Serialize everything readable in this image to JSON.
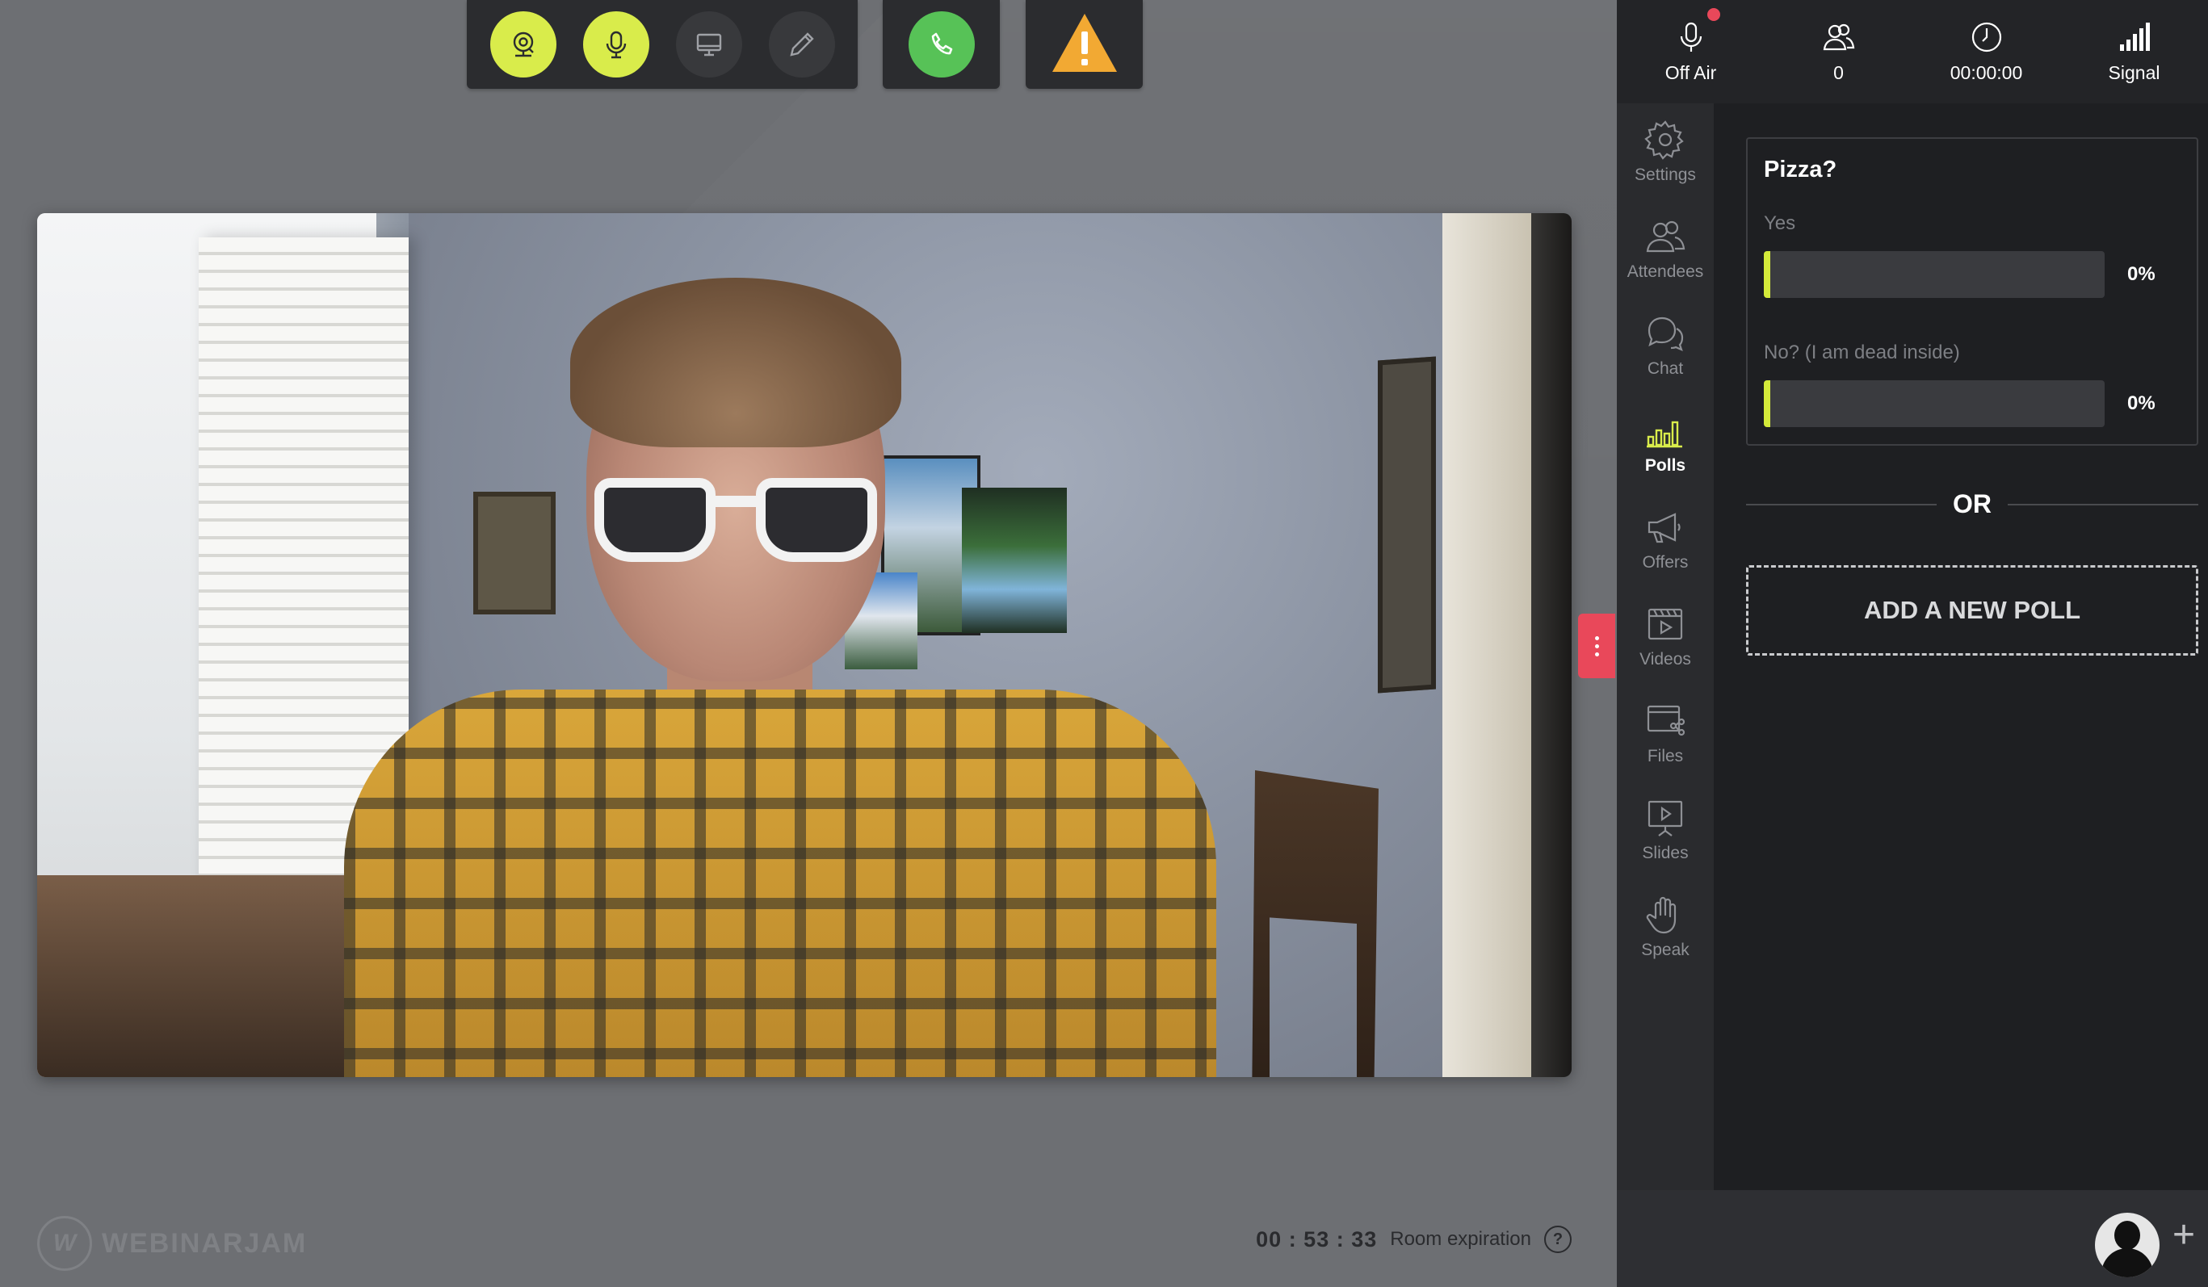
{
  "colors": {
    "accent": "#d9ec4b",
    "call": "#57c257",
    "warning": "#f2a933",
    "badge": "#e9485a"
  },
  "toolbar": {
    "buttons": [
      {
        "icon": "webcam-icon"
      },
      {
        "icon": "microphone-icon"
      },
      {
        "icon": "screen-share-icon"
      },
      {
        "icon": "pencil-icon"
      }
    ],
    "call_icon": "phone-icon",
    "warning_icon": "warning-icon"
  },
  "status": {
    "air": {
      "label": "Off Air",
      "icon": "microphone-icon"
    },
    "attendees": {
      "label": "0",
      "icon": "people-icon"
    },
    "timer": {
      "label": "00:00:00",
      "icon": "clock-icon"
    },
    "signal": {
      "label": "Signal",
      "icon": "signal-bars-icon"
    }
  },
  "nav": {
    "items": [
      {
        "label": "Settings",
        "icon": "gear-icon"
      },
      {
        "label": "Attendees",
        "icon": "people-icon"
      },
      {
        "label": "Chat",
        "icon": "chat-icon"
      },
      {
        "label": "Polls",
        "icon": "bar-chart-icon",
        "active": true
      },
      {
        "label": "Offers",
        "icon": "megaphone-icon"
      },
      {
        "label": "Videos",
        "icon": "video-clip-icon"
      },
      {
        "label": "Files",
        "icon": "files-icon"
      },
      {
        "label": "Slides",
        "icon": "presentation-icon"
      },
      {
        "label": "Speak",
        "icon": "hand-icon"
      }
    ]
  },
  "poll": {
    "question": "Pizza?",
    "options": [
      {
        "label": "Yes",
        "percent": "0%",
        "value": 0
      },
      {
        "label": "No? (I am dead inside)",
        "percent": "0%",
        "value": 0
      }
    ]
  },
  "divider_text": "OR",
  "add_poll_label": "ADD A NEW POLL",
  "brand": {
    "name": "WEBINARJAM",
    "mark": "W"
  },
  "expiry": {
    "time": "00 : 53 : 33",
    "label": "Room expiration",
    "help": "?"
  },
  "footer": {
    "plus": "+"
  }
}
